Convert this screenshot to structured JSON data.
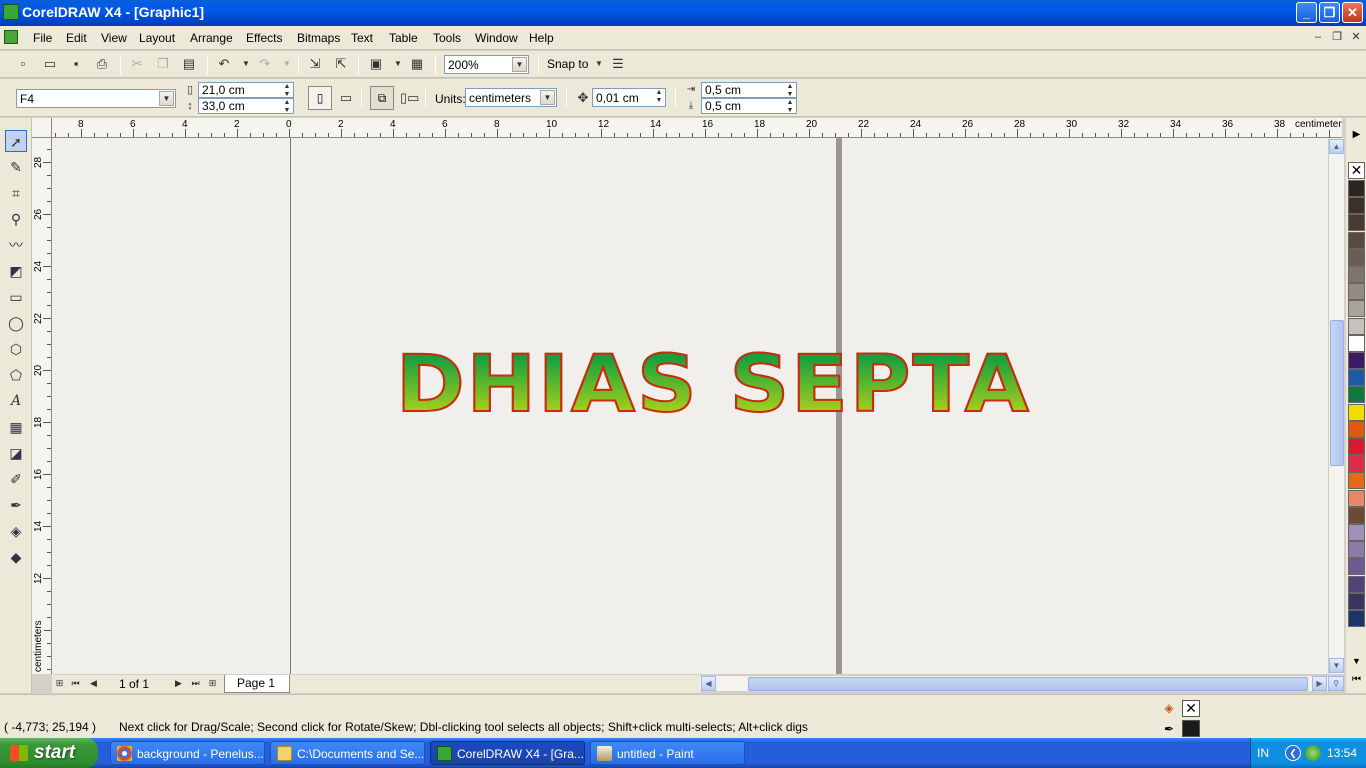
{
  "window": {
    "title": "CorelDRAW X4 - [Graphic1]"
  },
  "menu": [
    "File",
    "Edit",
    "View",
    "Layout",
    "Arrange",
    "Effects",
    "Bitmaps",
    "Text",
    "Table",
    "Tools",
    "Window",
    "Help"
  ],
  "toolbar": {
    "zoom": "200%",
    "snap_label": "Snap to"
  },
  "property_bar": {
    "paper_preset": "F4",
    "width": "21,0 cm",
    "height": "33,0 cm",
    "units_label": "Units:",
    "units_value": "centimeters",
    "nudge": "0,01 cm",
    "dup_x": "0,5 cm",
    "dup_y": "0,5 cm"
  },
  "ruler": {
    "h_labels": [
      "8",
      "6",
      "4",
      "2",
      "0",
      "2",
      "4",
      "6",
      "8",
      "10",
      "12",
      "14",
      "16",
      "18",
      "20",
      "22",
      "24",
      "26",
      "28",
      "30",
      "32",
      "34",
      "36",
      "38"
    ],
    "h_unit": "centimeters",
    "v_labels": [
      "28",
      "26",
      "24",
      "22",
      "20",
      "18",
      "16",
      "14",
      "12",
      "10"
    ],
    "v_unit": "centimeters"
  },
  "canvas": {
    "artistic_text": "DHIAS SEPTA",
    "text_colors": {
      "top": "#17a03d",
      "bottom": "#d7de12",
      "outline": "#cc2a10"
    }
  },
  "page_nav": {
    "counter": "1 of 1",
    "tab": "Page 1"
  },
  "status": {
    "coords": "( -4,773; 25,194 )",
    "hint": "Next click for Drag/Scale; Second click for Rotate/Skew; Dbl-clicking tool selects all objects; Shift+click multi-selects; Alt+click digs",
    "outline_color": "#1a1a1a"
  },
  "palette": [
    "#2b2421",
    "#3d3029",
    "#4a3a30",
    "#5a4a3f",
    "#6b5d52",
    "#7f7469",
    "#958b82",
    "#aaa29b",
    "#c7c1bc",
    "#ffffff",
    "#3a1a62",
    "#1d5aa8",
    "#0b7a3b",
    "#f2dd00",
    "#e05a10",
    "#d9192d",
    "#e02a4a",
    "#e46a1a",
    "#e8866c",
    "#6b4a34",
    "#a08fb8",
    "#8c7aa8",
    "#6e5a92",
    "#54437a",
    "#3b3460",
    "#1c3566"
  ],
  "taskbar": {
    "start": "start",
    "tasks": [
      "background - Penelus...",
      "C:\\Documents and Se...",
      "CorelDRAW X4 - [Gra...",
      "untitled - Paint"
    ],
    "lang": "IN",
    "clock": "13:54"
  }
}
